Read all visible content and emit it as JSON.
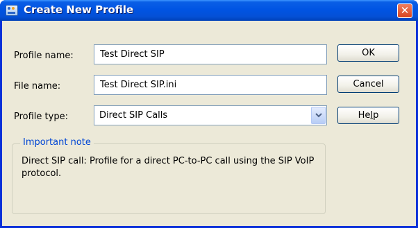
{
  "window": {
    "title": "Create New Profile",
    "close_glyph": "✕",
    "app_icon": "profile-app-icon"
  },
  "form": {
    "profile_name": {
      "label": "Profile name:",
      "value": "Test Direct SIP"
    },
    "file_name": {
      "label": "File name:",
      "value": "Test Direct SIP.ini"
    },
    "profile_type": {
      "label": "Profile type:",
      "value": "Direct SIP Calls"
    }
  },
  "buttons": {
    "ok": "OK",
    "cancel": "Cancel",
    "help_prefix": "He",
    "help_mnemonic": "l",
    "help_suffix": "p"
  },
  "note": {
    "title": "Important note",
    "text": "Direct SIP call: Profile for a direct PC-to-PC call using the SIP VoIP protocol."
  },
  "colors": {
    "titlebar": "#0054e3",
    "dialog_bg": "#ece9d8",
    "group_title": "#0046d5",
    "close_button": "#d8431f"
  }
}
